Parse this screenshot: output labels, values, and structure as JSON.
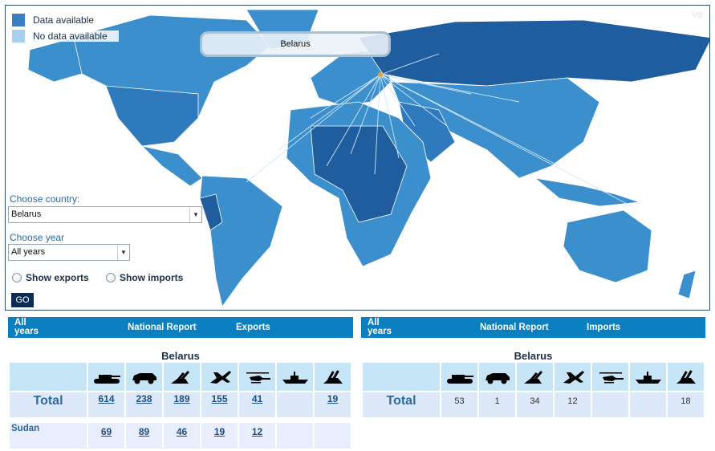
{
  "map": {
    "version": "V8",
    "tooltip": "Belarus",
    "legend": [
      {
        "label": "Data available",
        "color": "#3a7fc4"
      },
      {
        "label": "No data available",
        "color": "#a9cfee"
      }
    ],
    "colors": {
      "ocean": "#ffffff",
      "land_light": "#3a8fcc",
      "land_mid": "#2f79bd",
      "land_dark": "#1f5d9e",
      "selected": "#e7a32a"
    }
  },
  "controls": {
    "country_label": "Choose country:",
    "country_value": "Belarus",
    "year_label": "Choose year",
    "year_value": "All years",
    "show_exports": "Show exports",
    "show_imports": "Show imports",
    "go": "GO"
  },
  "exports_panel": {
    "header": {
      "years": "All years",
      "report": "National Report",
      "kind": "Exports"
    },
    "country": "Belarus",
    "icons": [
      "tank-icon",
      "armored-vehicle-icon",
      "artillery-icon",
      "fighter-jet-icon",
      "helicopter-icon",
      "warship-icon",
      "missile-launcher-icon"
    ],
    "total_label": "Total",
    "totals": [
      "614",
      "238",
      "189",
      "155",
      "41",
      "",
      "19"
    ],
    "rows": [
      {
        "country": "Sudan",
        "values": [
          "69",
          "89",
          "46",
          "19",
          "12",
          "",
          ""
        ]
      }
    ]
  },
  "imports_panel": {
    "header": {
      "years": "All years",
      "report": "National Report",
      "kind": "Imports"
    },
    "country": "Belarus",
    "icons": [
      "tank-icon",
      "armored-vehicle-icon",
      "artillery-icon",
      "fighter-jet-icon",
      "helicopter-icon",
      "warship-icon",
      "missile-launcher-icon"
    ],
    "total_label": "Total",
    "totals": [
      "53",
      "1",
      "34",
      "12",
      "",
      "",
      "18"
    ]
  }
}
